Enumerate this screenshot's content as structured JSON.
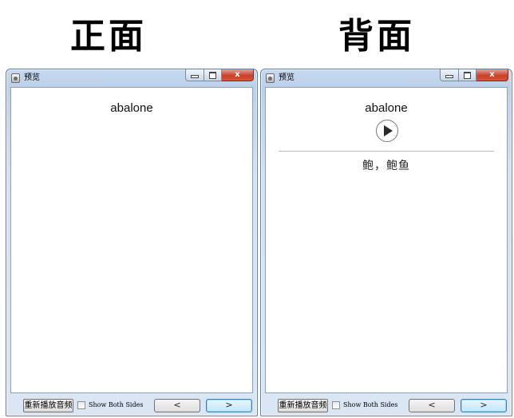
{
  "headings": {
    "front": "正面",
    "back": "背面"
  },
  "window": {
    "title": "预览",
    "caption_min": "",
    "caption_max": "",
    "caption_close": "x"
  },
  "card": {
    "word": "abalone",
    "definition": "鲍，鲍鱼"
  },
  "controls": {
    "replay_audio": "重新播放音频",
    "show_both_sides": "Show Both Sides",
    "show_both_sides_checked": false,
    "prev": "<",
    "next": ">"
  },
  "icons": {
    "app": "app-icon",
    "play": "play-icon"
  }
}
